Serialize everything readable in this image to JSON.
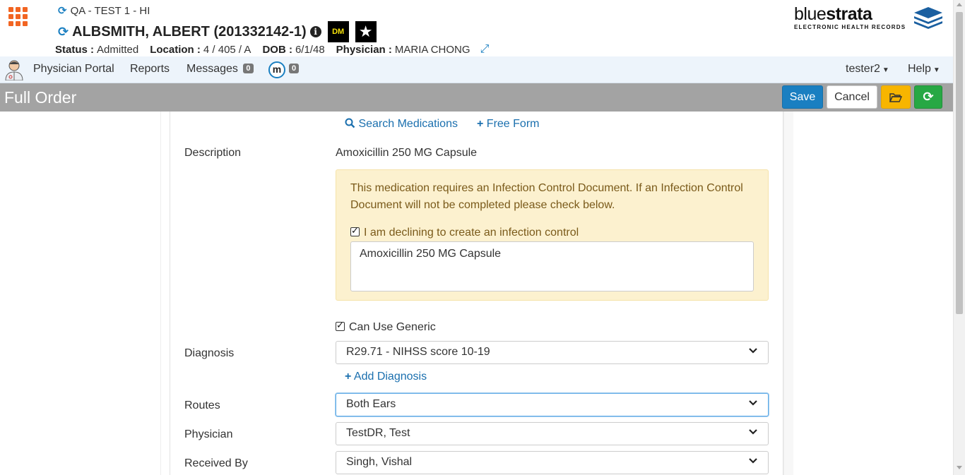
{
  "header": {
    "facility": "QA - TEST 1 - HI",
    "patient_name": "ALBSMITH, ALBERT (201332142-1)",
    "badges": [
      "DM"
    ],
    "status_label": "Status :",
    "status_value": "Admitted",
    "location_label": "Location :",
    "location_value": "4 / 405 / A",
    "dob_label": "DOB :",
    "dob_value": "6/1/48",
    "physician_label": "Physician :",
    "physician_value": "MARIA CHONG",
    "logo_light": "blue",
    "logo_bold": "strata",
    "logo_sub": "ELECTRONIC HEALTH RECORDS"
  },
  "nav": {
    "physician_portal": "Physician Portal",
    "reports": "Reports",
    "messages": "Messages",
    "messages_count": "0",
    "m_icon": "m",
    "m_count": "0",
    "user": "tester2",
    "help": "Help"
  },
  "titlebar": {
    "title": "Full Order",
    "save": "Save",
    "cancel": "Cancel"
  },
  "form": {
    "search_medications": "Search Medications",
    "free_form": "Free Form",
    "description_label": "Description",
    "description_value": "Amoxicillin 250 MG Capsule",
    "warning_text": "This medication requires an Infection Control Document. If an Infection Control Document will not be completed please check below.",
    "decline_label": "I am declining to create an infection control",
    "decline_checked": true,
    "decline_note": "Amoxicillin 250 MG Capsule",
    "generic_label": "Can Use Generic",
    "generic_checked": true,
    "diagnosis_label": "Diagnosis",
    "diagnosis_value": "R29.71 - NIHSS score 10-19",
    "add_diagnosis": "Add Diagnosis",
    "routes_label": "Routes",
    "routes_value": "Both Ears",
    "physician_label": "Physician",
    "physician_value": "TestDR, Test",
    "received_by_label": "Received By",
    "received_by_value": "Singh, Vishal"
  },
  "colors": {
    "primary": "#1a7fc1",
    "warning_bg": "#fcf1cf",
    "titlebar": "#a3a3a3",
    "success": "#27a844",
    "folder": "#f7b500",
    "grid_icon": "#f26522"
  },
  "icons": [
    "app-grid-icon",
    "refresh-icon",
    "info-icon",
    "star-icon",
    "expand-icon",
    "avatar-icon",
    "m-icon",
    "folder-icon",
    "search-icon",
    "plus-icon",
    "chevron-down-icon",
    "check-icon"
  ]
}
